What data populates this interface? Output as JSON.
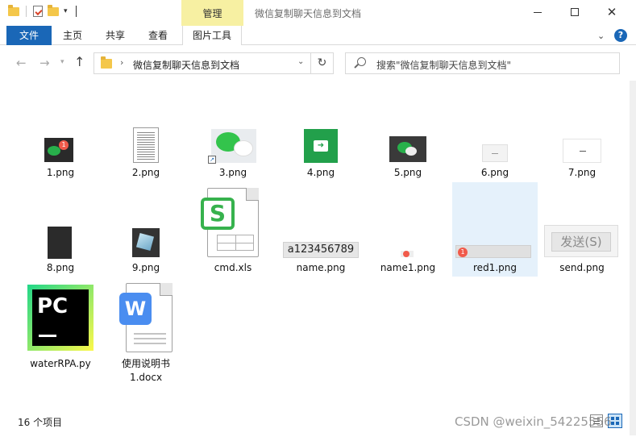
{
  "quick_access": {
    "folder_icon": "folder-icon",
    "properties_icon": "properties-icon",
    "customize_icon": "chevron-down-icon"
  },
  "ribbon": {
    "context_label": "管理",
    "tabs": [
      "文件",
      "主页",
      "共享",
      "查看",
      "图片工具"
    ],
    "accent": "#1a67b7",
    "context_color": "#f7f0a2"
  },
  "window": {
    "title": "微信复制聊天信息到文档"
  },
  "address": {
    "crumb": "微信复制聊天信息到文档",
    "search_placeholder": "搜索\"微信复制聊天信息到文档\""
  },
  "files": [
    {
      "name": "1.png"
    },
    {
      "name": "2.png"
    },
    {
      "name": "3.png"
    },
    {
      "name": "4.png"
    },
    {
      "name": "5.png"
    },
    {
      "name": "6.png"
    },
    {
      "name": "7.png"
    },
    {
      "name": "8.png"
    },
    {
      "name": "9.png"
    },
    {
      "name": "cmd.xls"
    },
    {
      "name": "name.png",
      "thumb_text": "a123456789"
    },
    {
      "name": "name1.png"
    },
    {
      "name": "red1.png",
      "selected": true,
      "badge": "1"
    },
    {
      "name": "send.png",
      "thumb_text": "发送(S)"
    },
    {
      "name": "waterRPA.py",
      "thumb_text": "PC"
    },
    {
      "name": "使用说明书",
      "name_line2": "1.docx"
    }
  ],
  "status": {
    "count": "16 个项目"
  },
  "watermark": "CSDN @weixin_54225556"
}
